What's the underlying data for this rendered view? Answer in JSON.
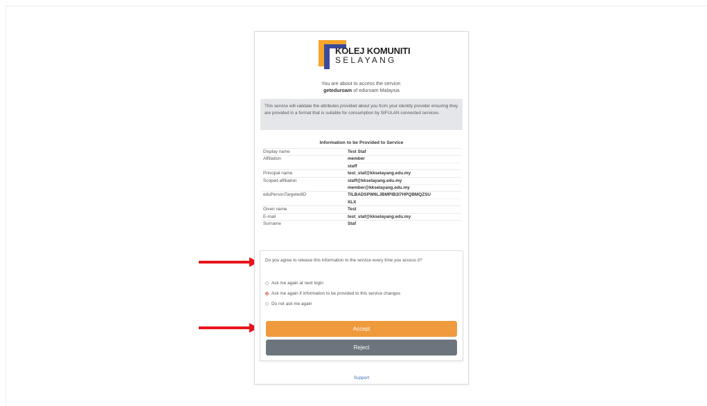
{
  "logo": {
    "line1": "KOLEJ KOMUNITI",
    "line2": "SELAYANG",
    "colors": {
      "orange": "#f4a52a",
      "blue": "#3b4a9c"
    }
  },
  "intro": {
    "line1": "You are about to access the service:",
    "service_name": "geteduroam",
    "of_text": "of eduroam Malaysia"
  },
  "notice": "This service will validate the attributes provided about you from your identity provider ensuring they are provided in a format that is suitable for consumption by SIFULAN connected services.",
  "info_title": "Information to be Provided to Service",
  "attributes": [
    {
      "key": "Display name",
      "values": [
        "Test Staf"
      ]
    },
    {
      "key": "Affiliation",
      "values": [
        "member",
        "staff"
      ]
    },
    {
      "key": "Principal name",
      "values": [
        "test_staf@kkselayang.edu.my"
      ]
    },
    {
      "key": "Scoped affiliation",
      "values": [
        "staff@kkselayang.edu.my",
        "member@kkselayang.edu.my"
      ]
    },
    {
      "key": "eduPersonTargetedID",
      "values": [
        "TILBADSPW6LJBMPIB3I7HPQBMQZSU",
        "XLX"
      ]
    },
    {
      "key": "Given name",
      "values": [
        "Test"
      ]
    },
    {
      "key": "E-mail",
      "values": [
        "test_staf@kkselayang.edu.my"
      ]
    },
    {
      "key": "Surname",
      "values": [
        "Staf"
      ]
    }
  ],
  "consent": {
    "question": "Do you agree to release this information to the service every time you access it?",
    "options": [
      {
        "label": "Ask me again at next login",
        "selected": false
      },
      {
        "label": "Ask me again if information to be provided to this service changes",
        "selected": true
      },
      {
        "label": "Do not ask me again",
        "selected": false
      }
    ],
    "accept_label": "Accept",
    "reject_label": "Reject"
  },
  "support_label": "Support",
  "colors": {
    "accept": "#ef9a3c",
    "reject": "#6c757d",
    "annotation_arrow": "#e8141b",
    "link": "#3a6fb0"
  }
}
